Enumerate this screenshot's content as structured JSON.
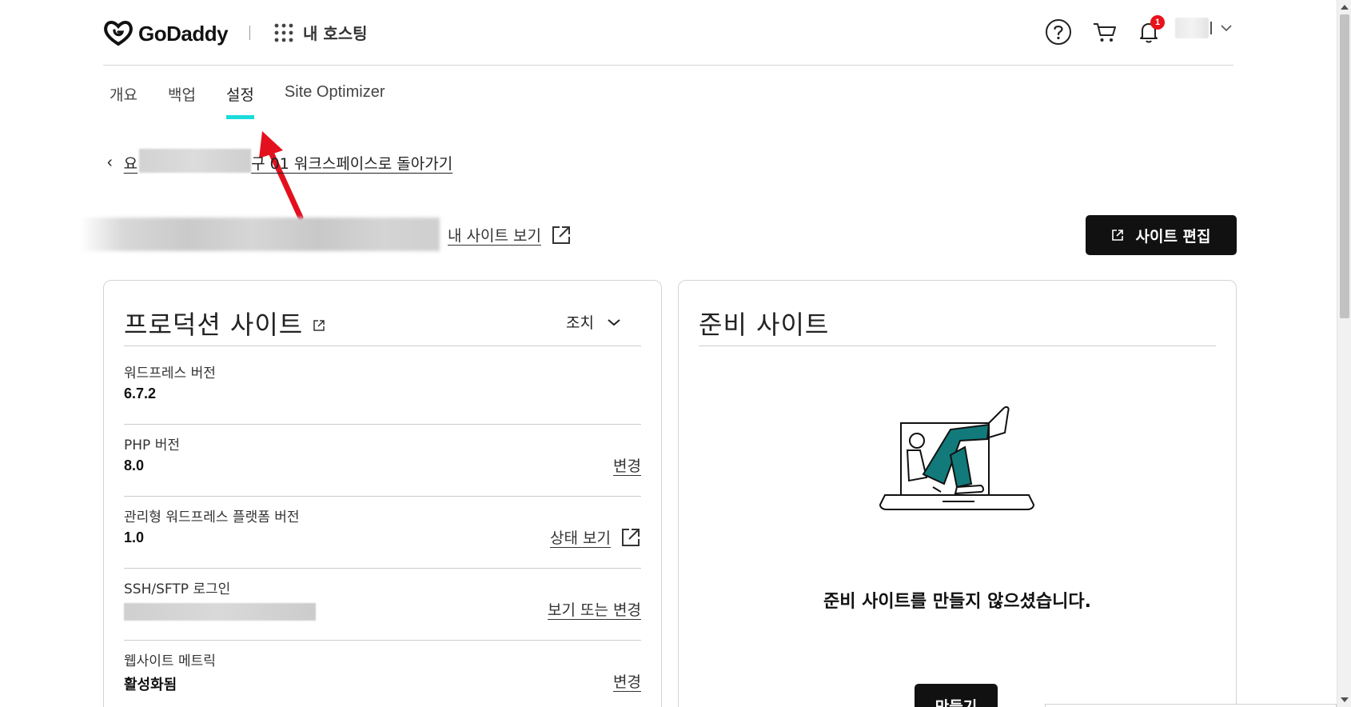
{
  "header": {
    "brand": "GoDaddy",
    "apps_label": "내 호스팅",
    "notification_count": "1",
    "icons": [
      "help-icon",
      "cart-icon",
      "bell-icon",
      "chevron-down-icon"
    ]
  },
  "tabs": [
    {
      "label": "개요",
      "active": false
    },
    {
      "label": "백업",
      "active": false
    },
    {
      "label": "설정",
      "active": true
    },
    {
      "label": "Site Optimizer",
      "active": false
    }
  ],
  "breadcrumb": {
    "visible_text": "구 01 워크스페이스로 돌아가기",
    "prefix_char": "요"
  },
  "site_header": {
    "view_site_label": "내 사이트 보기",
    "edit_button_label": "사이트 편집"
  },
  "production": {
    "title": "프로덕션 사이트",
    "actions_label": "조치",
    "rows": [
      {
        "label": "워드프레스 버전",
        "value": "6.7.2",
        "link": ""
      },
      {
        "label": "PHP 버전",
        "value": "8.0",
        "link": "변경"
      },
      {
        "label": "관리형 워드프레스 플랫폼 버전",
        "value": "1.0",
        "link": "상태 보기"
      },
      {
        "label": "SSH/SFTP 로그인",
        "value": "",
        "link": "보기 또는 변경"
      },
      {
        "label": "웹사이트 메트릭",
        "value": "활성화됨",
        "link": "변경"
      }
    ]
  },
  "staging": {
    "title": "준비 사이트",
    "message": "준비 사이트를 만들지 않으셨습니다.",
    "create_button_label": "만들기"
  },
  "colors": {
    "tab_indicator": "#1bdbdb",
    "annotation_arrow": "#e3101e",
    "badge": "#e8121b",
    "button_bg": "#111111",
    "illustration_pants": "#127a7a"
  }
}
